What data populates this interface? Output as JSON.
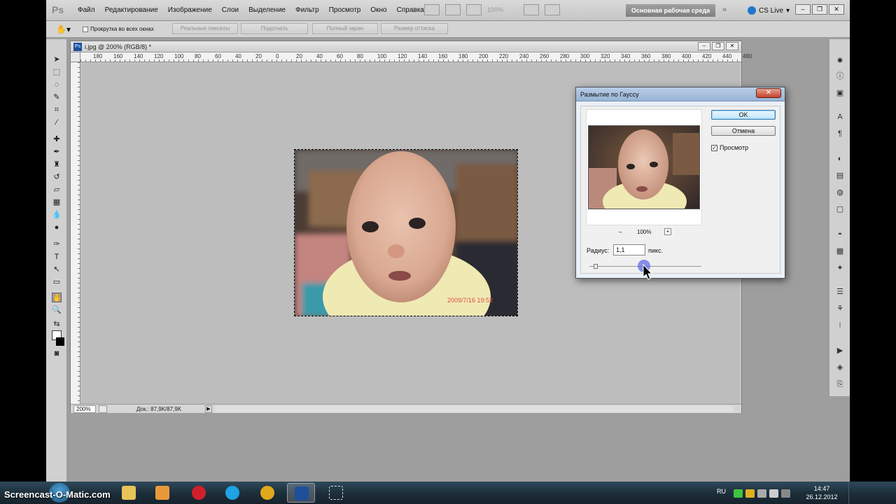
{
  "app": {
    "logo": "Ps",
    "menu": [
      "Файл",
      "Редактирование",
      "Изображение",
      "Слои",
      "Выделение",
      "Фильтр",
      "Просмотр",
      "Окно",
      "Справка"
    ],
    "zoom_combo": "100%",
    "workspace": "Основная рабочая среда",
    "more": "»",
    "cslive": "CS Live"
  },
  "options": {
    "scroll_all_windows": "Прокрутка во всех окнах",
    "buttons": [
      "Реальные пикселы",
      "Подогнать",
      "Полный экран",
      "Размер оттиска"
    ]
  },
  "document": {
    "title": "i.jpg @ 200% (RGB/8) *",
    "ruler_labels": [
      "180",
      "160",
      "140",
      "120",
      "100",
      "80",
      "60",
      "40",
      "20",
      "0",
      "20",
      "40",
      "60",
      "80",
      "100",
      "120",
      "140",
      "160",
      "180",
      "200",
      "220",
      "240",
      "260",
      "280",
      "300",
      "320",
      "340",
      "360",
      "380",
      "400",
      "420",
      "440",
      "460"
    ],
    "status_zoom": "200%",
    "status_info": "Док.: 87,9K/87,9K",
    "photo_stamp": "2009/7/16  19:52"
  },
  "dialog": {
    "title": "Размытие по Гауссу",
    "close": "✕",
    "ok": "OK",
    "cancel": "Отмена",
    "preview_label": "Просмотр",
    "preview_checked": true,
    "zoom_minus": "–",
    "zoom_pct": "100%",
    "zoom_plus": "+",
    "radius_label": "Радиус:",
    "radius_value": "1,1",
    "radius_unit": "пикс."
  },
  "taskbar": {
    "watermark": "Screencast-O-Matic.com",
    "lang": "RU",
    "time": "14:47",
    "date": "26.12.2012"
  },
  "colors": {
    "app_bg": "#9e9e9e",
    "workspace_btn": "#8f8f8f",
    "dialog_title": "#a9c1de",
    "close_red": "#c2422b"
  }
}
